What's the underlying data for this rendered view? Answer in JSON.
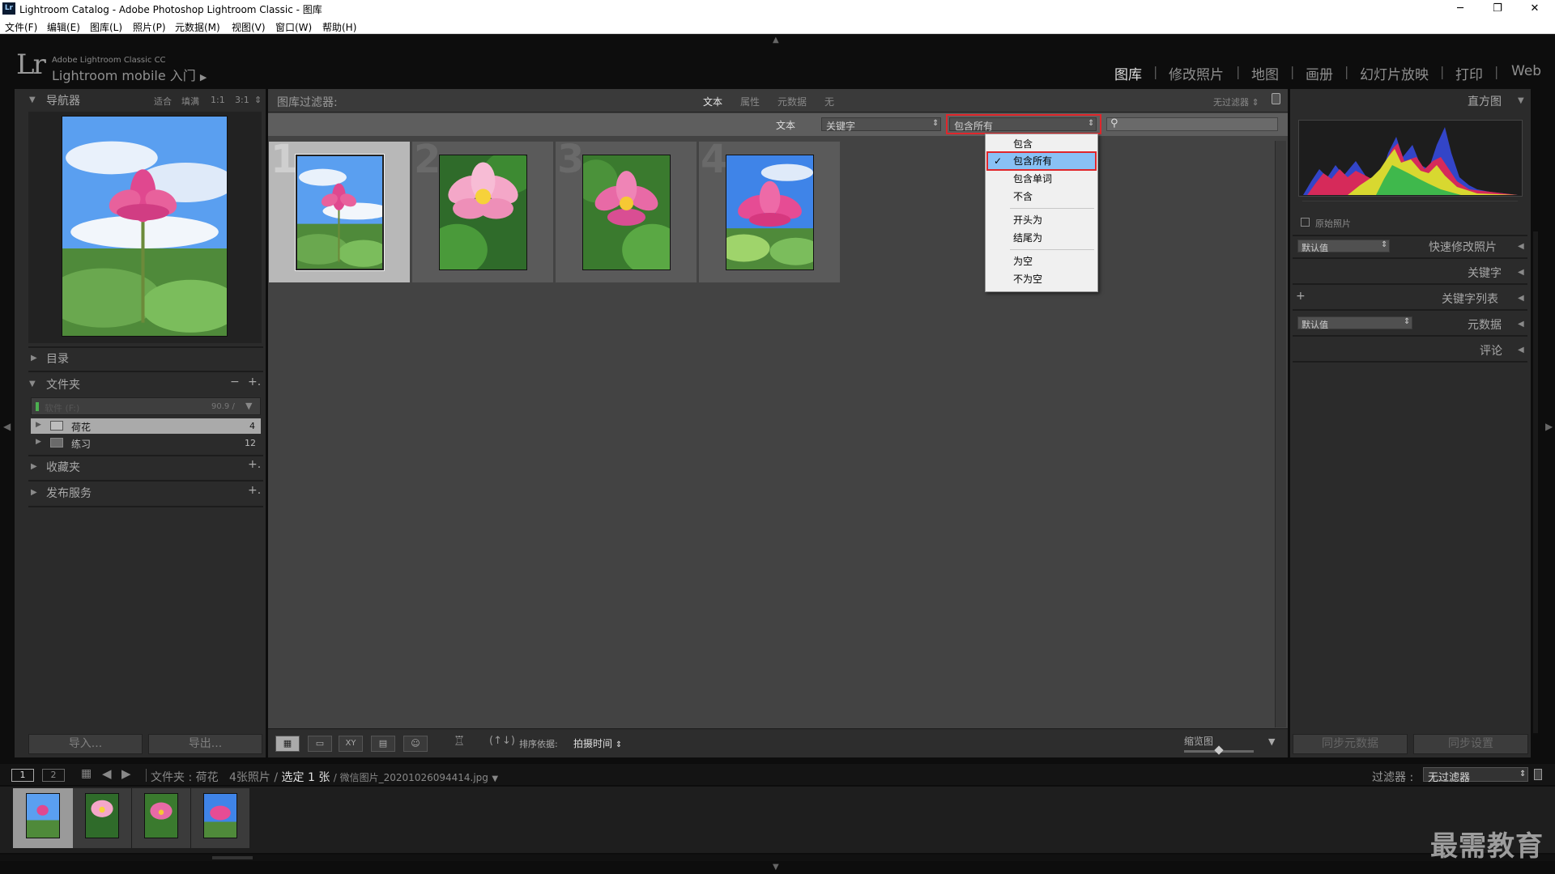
{
  "window": {
    "app_icon": "Lr",
    "title": "Lightroom Catalog - Adobe Photoshop Lightroom Classic - 图库",
    "minimize": "─",
    "maximize": "❐",
    "close": "✕"
  },
  "menu": [
    "文件(F)",
    "编辑(E)",
    "图库(L)",
    "照片(P)",
    "元数据(M)",
    "视图(V)",
    "窗口(W)",
    "帮助(H)"
  ],
  "identity": {
    "logo": "Lr",
    "product": "Adobe Lightroom Classic CC",
    "subtitle": "Lightroom mobile 入门",
    "subtitle_arrow": "▶"
  },
  "modules": [
    {
      "label": "图库",
      "active": true
    },
    {
      "label": "修改照片",
      "active": false
    },
    {
      "label": "地图",
      "active": false
    },
    {
      "label": "画册",
      "active": false
    },
    {
      "label": "幻灯片放映",
      "active": false
    },
    {
      "label": "打印",
      "active": false
    },
    {
      "label": "Web",
      "active": false
    }
  ],
  "left_panel": {
    "navigator": {
      "title": "导航器",
      "zoom": [
        "适合",
        "填满",
        "1:1",
        "3:1"
      ],
      "zoom_more": "⇕"
    },
    "catalog": {
      "title": "目录"
    },
    "folders": {
      "title": "文件夹",
      "minus": "−",
      "plus": "+.",
      "volume": {
        "name": "软件 (F:)",
        "size": "90.9 /"
      },
      "items": [
        {
          "name": "荷花",
          "count": "4"
        },
        {
          "name": "练习",
          "count": "12"
        }
      ]
    },
    "collections": {
      "title": "收藏夹",
      "plus": "+."
    },
    "publish": {
      "title": "发布服务",
      "plus": "+."
    },
    "import_label": "导入...",
    "export_label": "导出..."
  },
  "filter_bar": {
    "title": "图库过滤器:",
    "tabs": [
      "文本",
      "属性",
      "元数据",
      "无"
    ],
    "preset": "无过滤器",
    "text_label": "文本",
    "field_select": "关键字",
    "rule_select": "包含所有",
    "search_placeholder": ""
  },
  "dropdown": {
    "items": [
      {
        "label": "包含",
        "checked": false
      },
      {
        "label": "包含所有",
        "checked": true
      },
      {
        "label": "包含单词",
        "checked": false
      },
      {
        "label": "不含",
        "checked": false
      },
      {
        "label": "开头为",
        "checked": false
      },
      {
        "label": "结尾为",
        "checked": false
      },
      {
        "label": "为空",
        "checked": false
      },
      {
        "label": "不为空",
        "checked": false
      }
    ],
    "check": "✓"
  },
  "grid": {
    "cells": [
      {
        "number": "1",
        "selected": true
      },
      {
        "number": "2",
        "selected": false
      },
      {
        "number": "3",
        "selected": false
      },
      {
        "number": "4",
        "selected": false
      }
    ]
  },
  "toolbar": {
    "sort_label": "排序依据:",
    "sort_value": "拍摄时间",
    "thumbnail_label": "缩览图",
    "thumbnail_size": 0.5
  },
  "right_panel": {
    "histogram": {
      "title": "直方图"
    },
    "original_photo": "原始照片",
    "quick_develop": {
      "preset": "默认值",
      "title": "快速修改照片"
    },
    "keywording": {
      "title": "关键字"
    },
    "keyword_list": {
      "title": "关键字列表",
      "plus": "+"
    },
    "metadata": {
      "preset": "默认值",
      "title": "元数据"
    },
    "comments": {
      "title": "评论"
    },
    "sync_metadata": "同步元数据",
    "sync_settings": "同步设置"
  },
  "filmstrip": {
    "view1": "1",
    "view2": "2",
    "breadcrumb_prefix": "文件夹 : 荷花",
    "count": "4张照片 /",
    "selected": "选定 1 张",
    "filename": "/ 微信图片_20201026094414.jpg",
    "filter_label": "过滤器 :",
    "filter_value": "无过滤器"
  },
  "watermark": "最需教育",
  "colors": {
    "accent_red": "#e0262b",
    "selection_blue": "#89c1f5"
  }
}
